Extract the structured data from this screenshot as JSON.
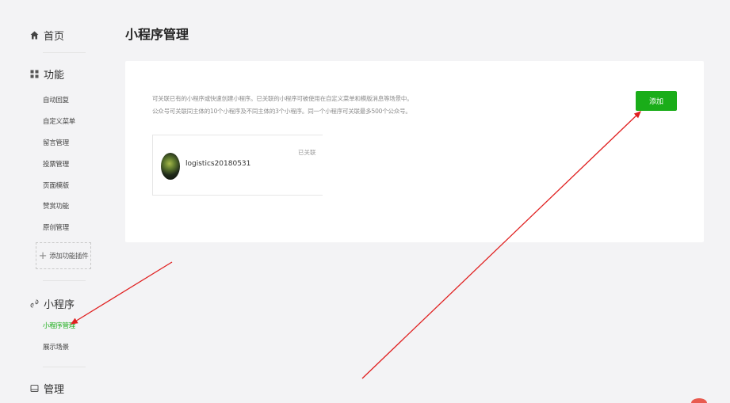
{
  "sidebar": {
    "home": {
      "label": "首页",
      "icon": "home-icon"
    },
    "features": {
      "label": "功能",
      "icon": "grid-icon",
      "items": [
        {
          "label": "自动回复"
        },
        {
          "label": "自定义菜单"
        },
        {
          "label": "留言管理"
        },
        {
          "label": "投票管理"
        },
        {
          "label": "页面模版"
        },
        {
          "label": "赞赏功能"
        },
        {
          "label": "原创管理"
        }
      ],
      "add_plugin_label": "添加功能插件"
    },
    "miniprogram": {
      "label": "小程序",
      "icon": "link-icon",
      "items": [
        {
          "label": "小程序管理",
          "active": true
        },
        {
          "label": "展示场景"
        }
      ]
    },
    "manage": {
      "label": "管理",
      "icon": "manage-icon"
    }
  },
  "main": {
    "title": "小程序管理",
    "description_line1": "可关联已有的小程序或快速创建小程序。已关联的小程序可被使用在自定义菜单和模版消息等场景中。",
    "description_line2": "公众号可关联同主体的10个小程序及不同主体的3个小程序。同一个小程序可关联最多500个公众号。",
    "add_button_label": "添加",
    "linked_miniprograms": [
      {
        "name": "logistics20180531",
        "status": "已关联"
      }
    ]
  },
  "colors": {
    "accent": "#1aad19",
    "annotation_arrow": "#e02020"
  }
}
